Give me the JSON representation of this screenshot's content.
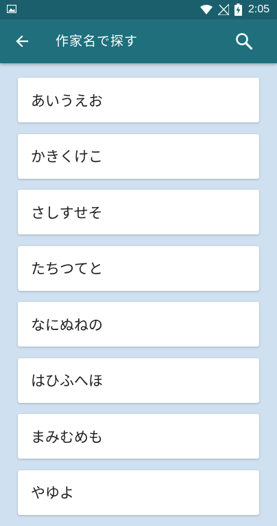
{
  "status_bar": {
    "time": "2:05",
    "icons": [
      "image-icon",
      "wifi-icon",
      "no-signal-icon",
      "battery-charging-icon"
    ]
  },
  "app_bar": {
    "title": "作家名で探す",
    "back_icon": "arrow-left-icon",
    "search_icon": "search-icon"
  },
  "colors": {
    "status_bar": "#1b5f6c",
    "app_bar": "#1f6f7d",
    "background": "#cfe0f0",
    "card": "#ffffff"
  },
  "rows": [
    {
      "label": "あいうえお"
    },
    {
      "label": "かきくけこ"
    },
    {
      "label": "さしすせそ"
    },
    {
      "label": "たちつてと"
    },
    {
      "label": "なにぬねの"
    },
    {
      "label": "はひふへほ"
    },
    {
      "label": "まみむめも"
    },
    {
      "label": "やゆよ"
    }
  ]
}
